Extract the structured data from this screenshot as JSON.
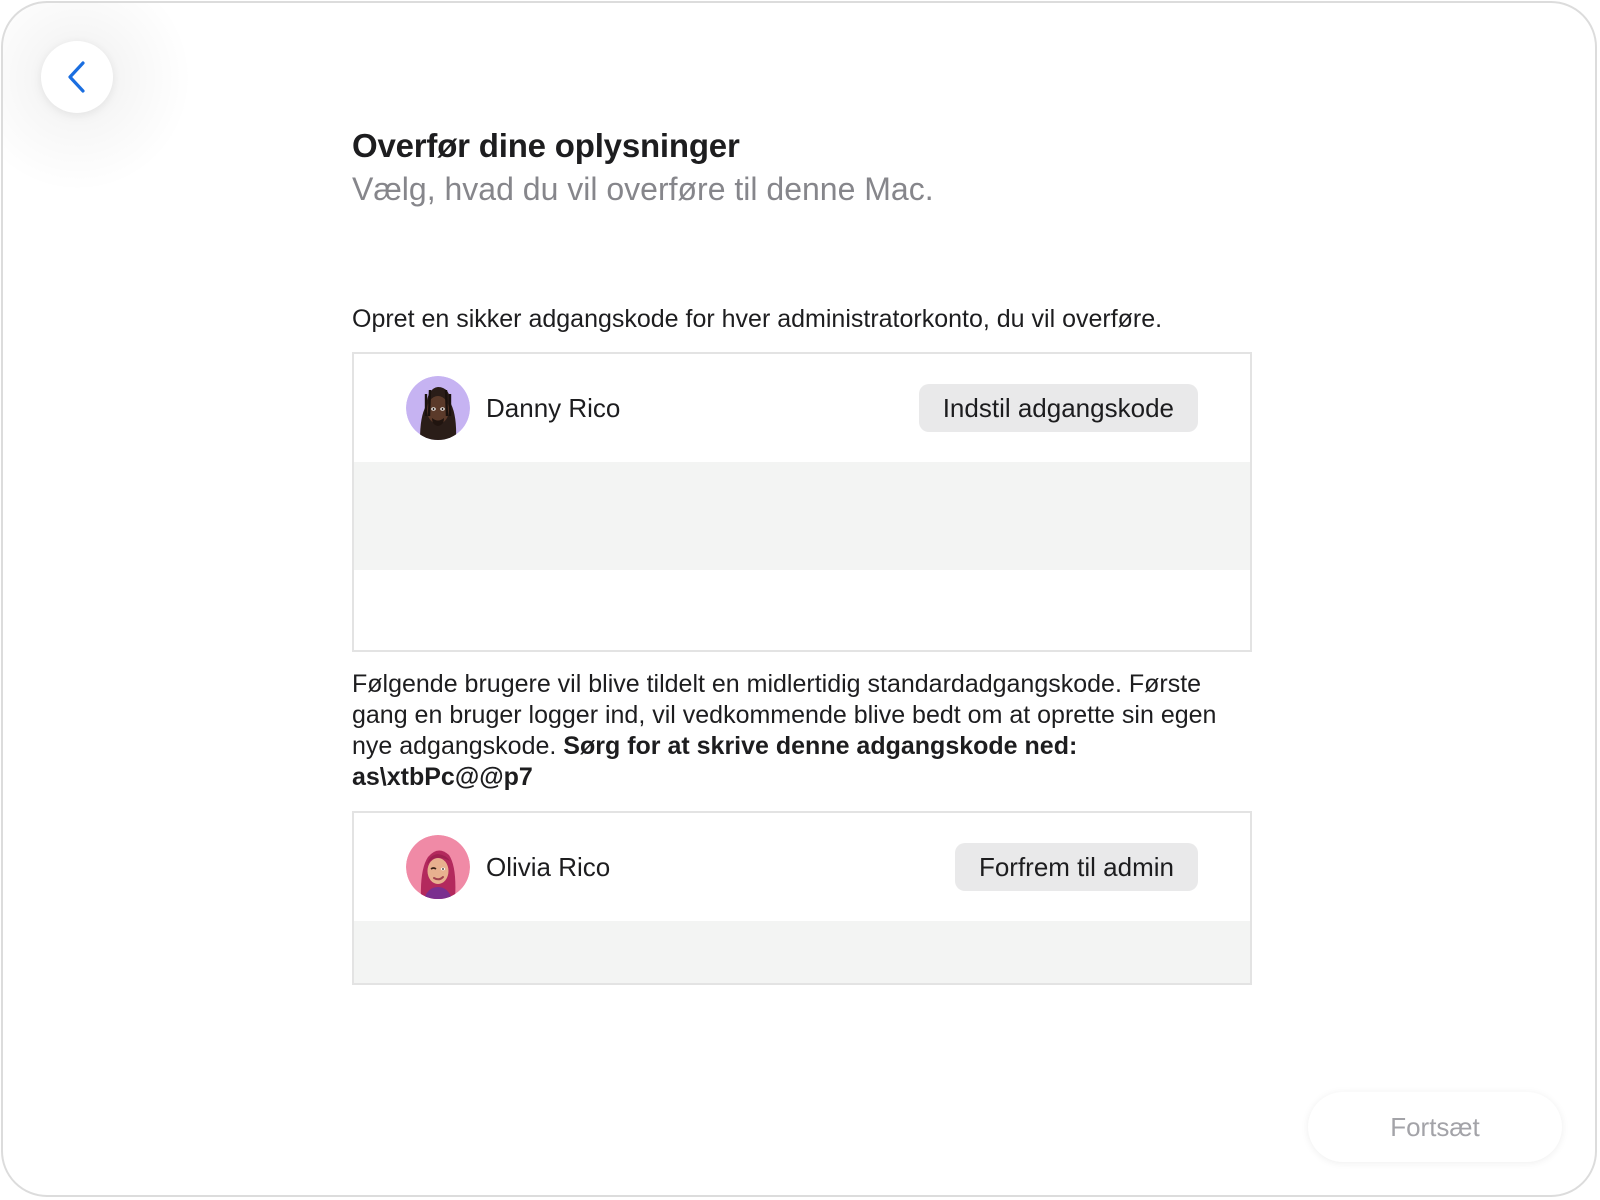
{
  "header": {
    "title": "Overfør dine oplysninger",
    "subtitle": "Vælg, hvad du vil overføre til denne Mac."
  },
  "admin_section": {
    "instruction": "Opret en sikker adgangskode for hver administratorkonto, du vil overføre.",
    "users": [
      {
        "name": "Danny Rico",
        "button_label": "Indstil adgangskode",
        "avatar_icon": "memoji-avatar-danny"
      }
    ]
  },
  "standard_section": {
    "info_text": "Følgende brugere vil blive tildelt en midlertidig standardadgangskode. Første gang en bruger logger ind, vil vedkommende blive bedt om at oprette sin egen nye adgangskode.",
    "info_bold": "Sørg for at skrive denne adgangskode ned: as\\xtbPc@@p7",
    "users": [
      {
        "name": "Olivia Rico",
        "button_label": "Forfrem til admin",
        "avatar_icon": "memoji-avatar-olivia"
      }
    ]
  },
  "footer": {
    "continue_label": "Fortsæt"
  },
  "navigation": {
    "back_icon": "chevron-left-icon"
  },
  "colors": {
    "accent": "#1a6ee0",
    "stripe": "#f3f4f3",
    "disabled_text": "#a3a3a8"
  }
}
